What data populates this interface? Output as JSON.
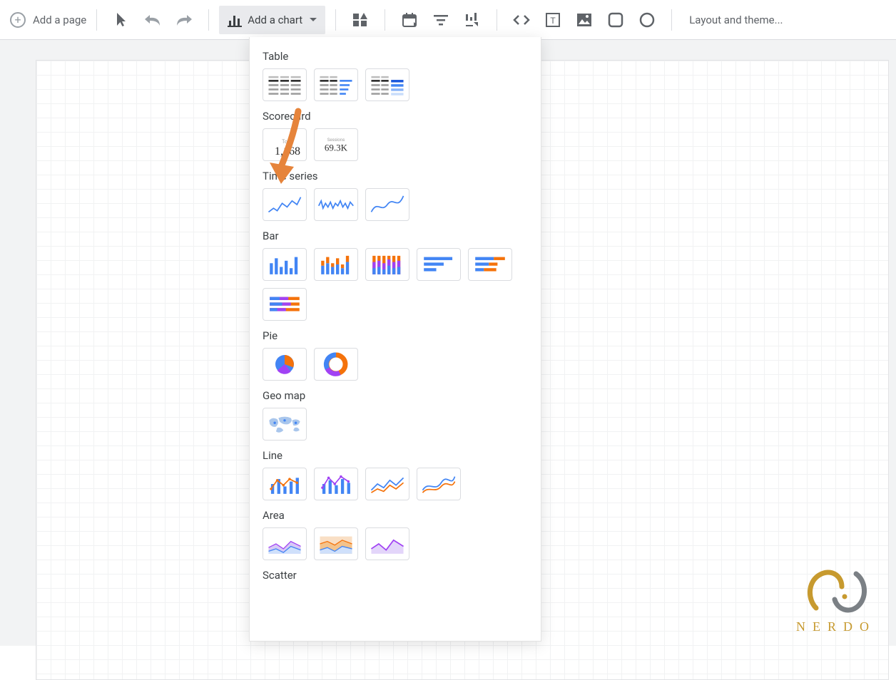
{
  "toolbar": {
    "add_page": "Add a page",
    "add_chart": "Add a chart",
    "layout_theme": "Layout and theme..."
  },
  "panel": {
    "headings": {
      "table": "Table",
      "scorecard": "Scorecard",
      "time_series": "Time series",
      "bar": "Bar",
      "pie": "Pie",
      "geo_map": "Geo map",
      "line": "Line",
      "area": "Area",
      "scatter": "Scatter"
    },
    "scorecard2_label": "Sessions",
    "scorecard2_value": "69.3K"
  },
  "watermark": {
    "text": "NERDO"
  }
}
